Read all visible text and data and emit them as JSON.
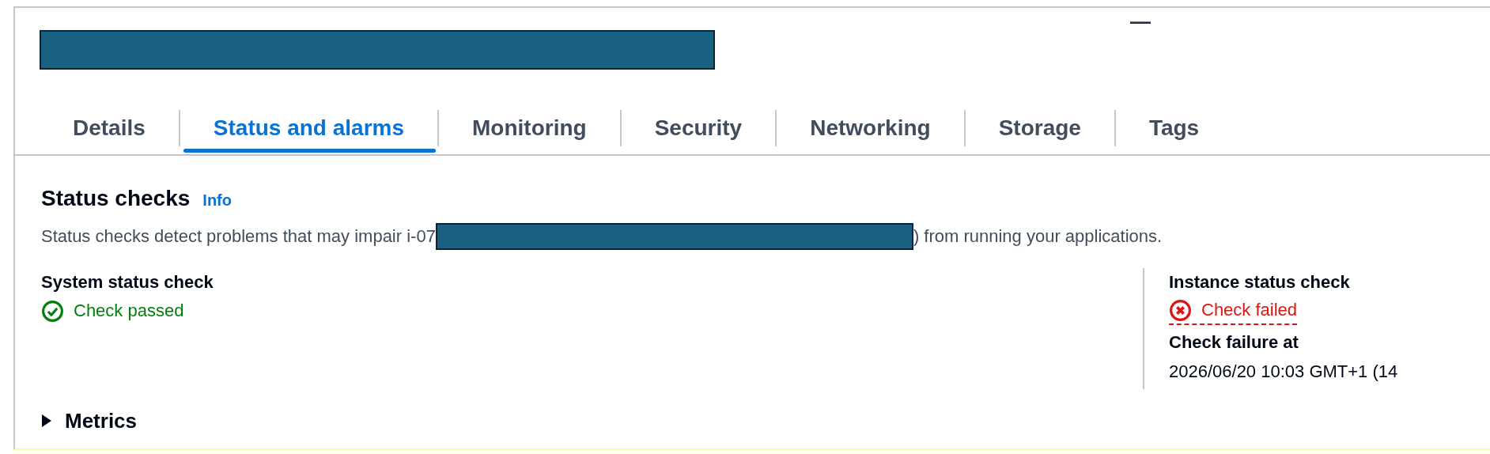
{
  "header": {
    "minimize": "—"
  },
  "tabs": [
    {
      "label": "Details",
      "selected": false
    },
    {
      "label": "Status and alarms",
      "selected": true
    },
    {
      "label": "Monitoring",
      "selected": false
    },
    {
      "label": "Security",
      "selected": false
    },
    {
      "label": "Networking",
      "selected": false
    },
    {
      "label": "Storage",
      "selected": false
    },
    {
      "label": "Tags",
      "selected": false
    }
  ],
  "status_checks": {
    "title": "Status checks",
    "info_link": "Info",
    "description_start": "Status checks detect problems that may impair i-07",
    "description_end": ") from running your applications.",
    "checks": [
      {
        "title": "System status check",
        "passed": true,
        "status_text": "Check passed"
      },
      {
        "title": "Instance status check",
        "passed": false,
        "status_text": "Check failed",
        "failure_label": "Check failure at",
        "failure_time": "2026/06/20 10:03 GMT+1 (14"
      }
    ]
  },
  "metrics": {
    "label": "Metrics",
    "expanded": false
  }
}
